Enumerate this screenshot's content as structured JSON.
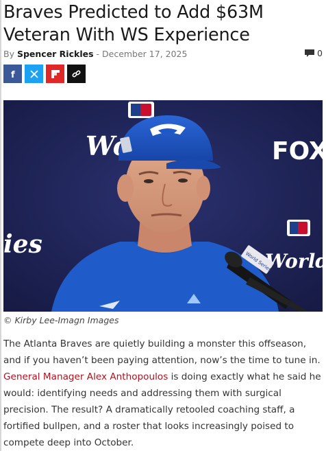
{
  "article": {
    "title": "Braves Predicted to Add $63M Veteran With WS Experience",
    "byline_prefix": "By ",
    "author": "Spencer Rickles",
    "date_sep": " - ",
    "date": "December 17, 2025",
    "comment_count": "0"
  },
  "share": [
    {
      "name": "facebook-share-button",
      "icon": "facebook-icon",
      "color": "#3b5998"
    },
    {
      "name": "x-share-button",
      "icon": "x-icon",
      "color": "#1da1f2"
    },
    {
      "name": "flipboard-share-button",
      "icon": "flipboard-icon",
      "color": "#e12828"
    },
    {
      "name": "copy-link-button",
      "icon": "link-icon",
      "color": "#111111"
    }
  ],
  "photo": {
    "caption": "© Kirby Lee-Imagn Images",
    "backdrop_text_left": "Wo",
    "backdrop_text_fox": "FOX",
    "backdrop_text_ies": "ies",
    "backdrop_text_right": "World Se",
    "mic_label": "World Series"
  },
  "body": {
    "p1_start": "The Atlanta Braves are quietly building a monster this offseason, and if you haven’t been paying attention, now’s the time to tune in. ",
    "p1_link": "General Manager Alex Anthopoulos",
    "p1_end": " is doing exactly what he said he would: identifying needs and addressing them with surgical precision. The result? A dramatically retooled coaching staff, a fortified bullpen, and a roster that looks increasingly poised to compete deep into October."
  },
  "colors": {
    "link": "#b0121f",
    "jays_blue": "#1d58c9",
    "backdrop": "#1f2456"
  }
}
